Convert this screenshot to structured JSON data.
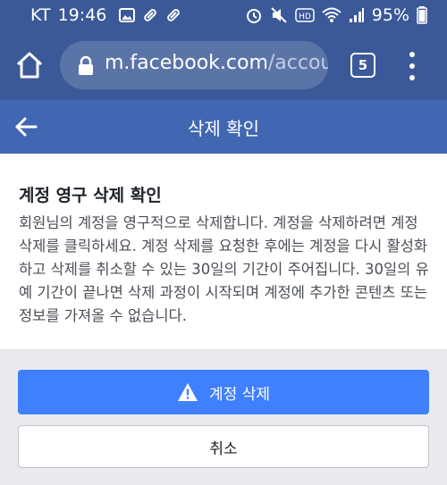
{
  "status_bar": {
    "carrier": "KT",
    "time": "19:46",
    "battery": "95%"
  },
  "browser": {
    "url_host": "m.facebook.com",
    "url_path": "/accou",
    "tab_count": "5"
  },
  "header": {
    "title": "삭제 확인"
  },
  "card": {
    "title": "계정 영구 삭제 확인",
    "body": "회원님의 계정을 영구적으로 삭제합니다. 계정을 삭제하려면 계정 삭제를 클릭하세요. 계정 삭제를 요청한 후에는 계정을 다시 활성화하고 삭제를 취소할 수 있는 30일의 기간이 주어집니다. 30일의 유예 기간이 끝나면 삭제 과정이 시작되며 계정에 추가한 콘텐츠 또는 정보를 가져올 수 없습니다."
  },
  "actions": {
    "delete_label": "계정 삭제",
    "cancel_label": "취소"
  },
  "colors": {
    "facebook_blue": "#3b5998",
    "header_blue": "#4267b2",
    "button_blue": "#4080ff"
  },
  "icons": [
    "image-icon",
    "pill-icon",
    "alarm-icon",
    "mute-icon",
    "hd-icon",
    "wifi-icon",
    "signal-icon",
    "home-icon",
    "lock-icon",
    "tabs-icon",
    "menu-icon",
    "back-arrow-icon",
    "warning-icon"
  ]
}
